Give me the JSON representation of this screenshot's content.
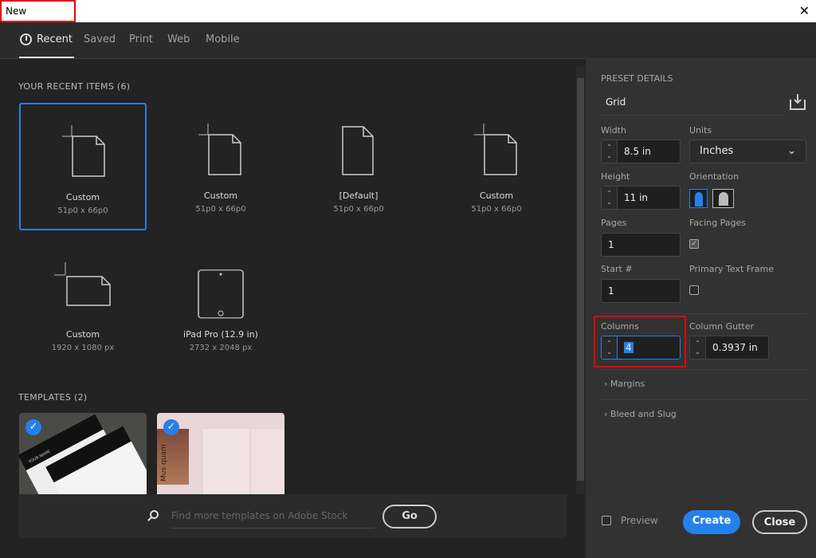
{
  "window": {
    "title": "New Document",
    "close": "✕"
  },
  "tabs": [
    {
      "label": "Recent"
    },
    {
      "label": "Saved"
    },
    {
      "label": "Print"
    },
    {
      "label": "Web"
    },
    {
      "label": "Mobile"
    }
  ],
  "recent": {
    "heading": "YOUR RECENT ITEMS",
    "count": "(6)",
    "items": [
      {
        "name": "Custom",
        "size": "51p0 x 66p0"
      },
      {
        "name": "Custom",
        "size": "51p0 x 66p0"
      },
      {
        "name": "[Default]",
        "size": "51p0 x 66p0"
      },
      {
        "name": "Custom",
        "size": "51p0 x 66p0"
      },
      {
        "name": "Custom",
        "size": "1920 x 1080 px"
      },
      {
        "name": "iPad Pro (12.9 in)",
        "size": "2732 x 2048 px"
      }
    ]
  },
  "templates": {
    "heading": "TEMPLATES",
    "count": "(2)",
    "t1_text": "YOUR NAME",
    "t2_text": "Mus quam"
  },
  "search": {
    "placeholder": "Find more templates on Adobe Stock",
    "go": "Go"
  },
  "preset": {
    "heading": "PRESET DETAILS",
    "name": "Grid",
    "width_label": "Width",
    "width": "8.5 in",
    "units_label": "Units",
    "units": "Inches",
    "height_label": "Height",
    "height": "11 in",
    "orientation_label": "Orientation",
    "pages_label": "Pages",
    "pages": "1",
    "facing_label": "Facing Pages",
    "facing_checked": true,
    "start_label": "Start #",
    "start": "1",
    "ptf_label": "Primary Text Frame",
    "ptf_checked": false,
    "columns_label": "Columns",
    "columns": "4",
    "gutter_label": "Column Gutter",
    "gutter": "0.3937 in",
    "margins": "Margins",
    "bleed": "Bleed and Slug"
  },
  "footer": {
    "preview": "Preview",
    "create": "Create",
    "close": "Close"
  },
  "colors": {
    "accent": "#2680eb"
  }
}
